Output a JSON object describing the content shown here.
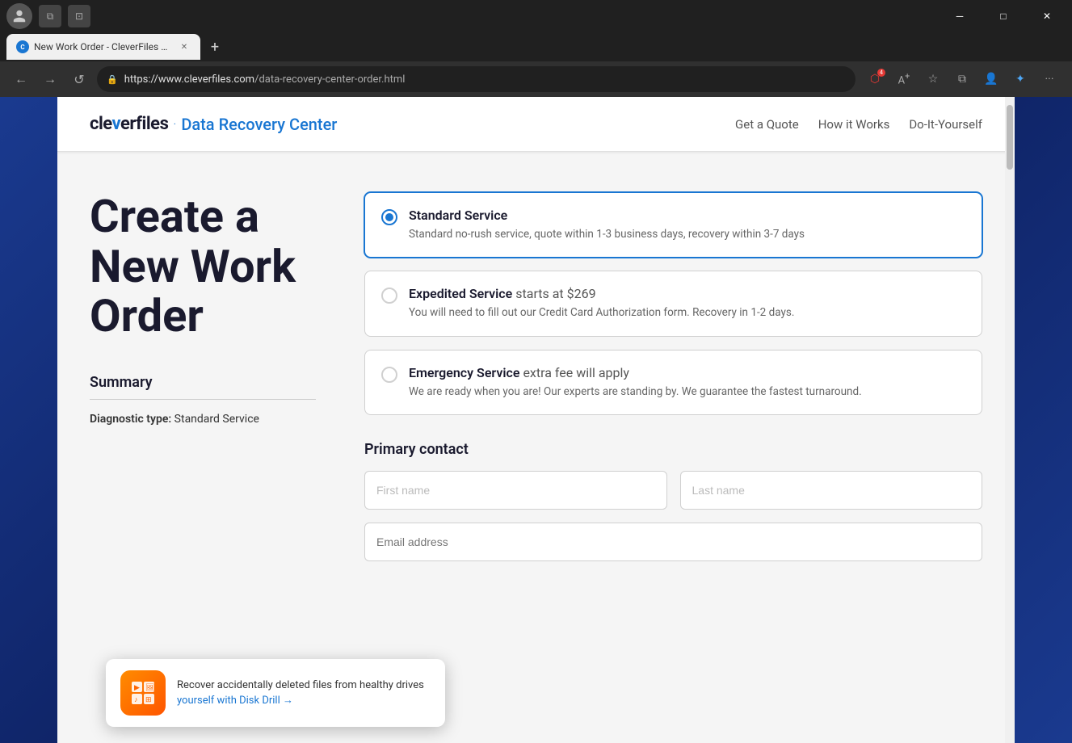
{
  "browser": {
    "tab_title": "New Work Order - CleverFiles D...",
    "url_display": "https://www.cleverfiles.com/data-recovery-center-order.html",
    "url_domain": "https://www.cleverfiles.com",
    "url_path": "/data-recovery-center-order.html",
    "new_tab_label": "+",
    "back_label": "←",
    "forward_label": "→",
    "refresh_label": "↺"
  },
  "header": {
    "logo_text_start": "cle",
    "logo_text_v": "v",
    "logo_text_end": "erfiles",
    "logo_separator": "·",
    "logo_subtitle": "Data Recovery Center",
    "nav": {
      "get_quote": "Get a Quote",
      "how_it_works": "How it Works",
      "do_it_yourself": "Do-It-Yourself"
    }
  },
  "main": {
    "page_title": "Create a New Work Order",
    "summary_label": "Summary",
    "diagnostic_type_label": "Diagnostic type:",
    "diagnostic_type_value": "Standard Service",
    "services": [
      {
        "id": "standard",
        "name": "Standard Service",
        "price": "",
        "description": "Standard no-rush service, quote within 1-3 business days, recovery within 3-7 days",
        "selected": true
      },
      {
        "id": "expedited",
        "name": "Expedited Service",
        "price": "starts at $269",
        "description": "You will need to fill out our Credit Card Authorization form. Recovery in 1-2 days.",
        "selected": false
      },
      {
        "id": "emergency",
        "name": "Emergency Service",
        "price": "extra fee will apply",
        "description": "We are ready when you are! Our experts are standing by. We guarantee the fastest turnaround.",
        "selected": false
      }
    ],
    "contact_section_label": "Primary contact",
    "first_name_placeholder": "First name",
    "last_name_placeholder": "Last name",
    "email_placeholder": "Email address"
  },
  "toast": {
    "text_plain": "Recover accidentally deleted files from healthy drives ",
    "text_link": "yourself with Disk Drill →",
    "icon": "🗂️"
  }
}
